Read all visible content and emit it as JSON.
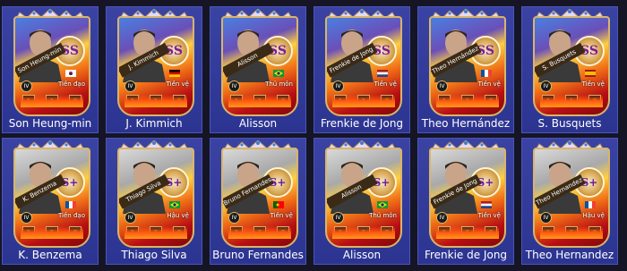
{
  "cards": [
    {
      "name": "Son Heung-min",
      "sash": "Son Heung-min",
      "position": "Tiền đạo",
      "tier": "SS",
      "level": "IV",
      "flag": "kr",
      "stats": [
        "1",
        "1",
        "0"
      ],
      "theme": "blue"
    },
    {
      "name": "J. Kimmich",
      "sash": "J. Kimmich",
      "position": "Tiền vệ",
      "tier": "SS",
      "level": "IV",
      "flag": "de",
      "stats": [
        "1",
        "1",
        "0"
      ],
      "theme": "blue"
    },
    {
      "name": "Alisson",
      "sash": "Alisson",
      "position": "Thủ môn",
      "tier": "SS",
      "level": "IV",
      "flag": "br",
      "stats": [
        "1",
        "1",
        "0"
      ],
      "theme": "blue"
    },
    {
      "name": "Frenkie de Jong",
      "sash": "Frenkie de Jong",
      "position": "Tiền vệ",
      "tier": "SS",
      "level": "IV",
      "flag": "nl",
      "stats": [
        "1",
        "1",
        "0"
      ],
      "theme": "blue"
    },
    {
      "name": "Theo Hernández",
      "sash": "Theo Hernández",
      "position": "Tiền vệ",
      "tier": "SS",
      "level": "IV",
      "flag": "fr",
      "stats": [
        "1",
        "1",
        "0"
      ],
      "theme": "blue"
    },
    {
      "name": "S. Busquets",
      "sash": "S. Busquets",
      "position": "Tiền vệ",
      "tier": "SS",
      "level": "IV",
      "flag": "es",
      "stats": [
        "1",
        "1",
        "0"
      ],
      "theme": "blue"
    },
    {
      "name": "K. Benzema",
      "sash": "K. Benzema",
      "position": "Tiền đạo",
      "tier": "S+",
      "level": "IV",
      "flag": "fr",
      "stats": [
        "1",
        "1",
        "0"
      ],
      "theme": "gray"
    },
    {
      "name": "Thiago Silva",
      "sash": "Thiago Silva",
      "position": "Hậu vệ",
      "tier": "S+",
      "level": "IV",
      "flag": "br",
      "stats": [
        "1",
        "1",
        "0"
      ],
      "theme": "gray"
    },
    {
      "name": "Bruno Fernandes",
      "sash": "Bruno Fernandes",
      "position": "Tiền vệ",
      "tier": "S+",
      "level": "IV",
      "flag": "pt",
      "stats": [
        "1",
        "1",
        "0"
      ],
      "theme": "gray"
    },
    {
      "name": "Alisson",
      "sash": "Alisson",
      "position": "Thủ môn",
      "tier": "S+",
      "level": "IV",
      "flag": "br",
      "stats": [
        "1",
        "1",
        "0"
      ],
      "theme": "gray"
    },
    {
      "name": "Frenkie de Jong",
      "sash": "Frenkie de Jong",
      "position": "Tiền vệ",
      "tier": "S+",
      "level": "IV",
      "flag": "nl",
      "stats": [
        "1",
        "1",
        "0"
      ],
      "theme": "gray"
    },
    {
      "name": "Theo Hernandez",
      "sash": "Theo Hernandez",
      "position": "Hậu vệ",
      "tier": "S+",
      "level": "IV",
      "flag": "fr",
      "stats": [
        "1",
        "1",
        "0"
      ],
      "theme": "gray"
    }
  ]
}
